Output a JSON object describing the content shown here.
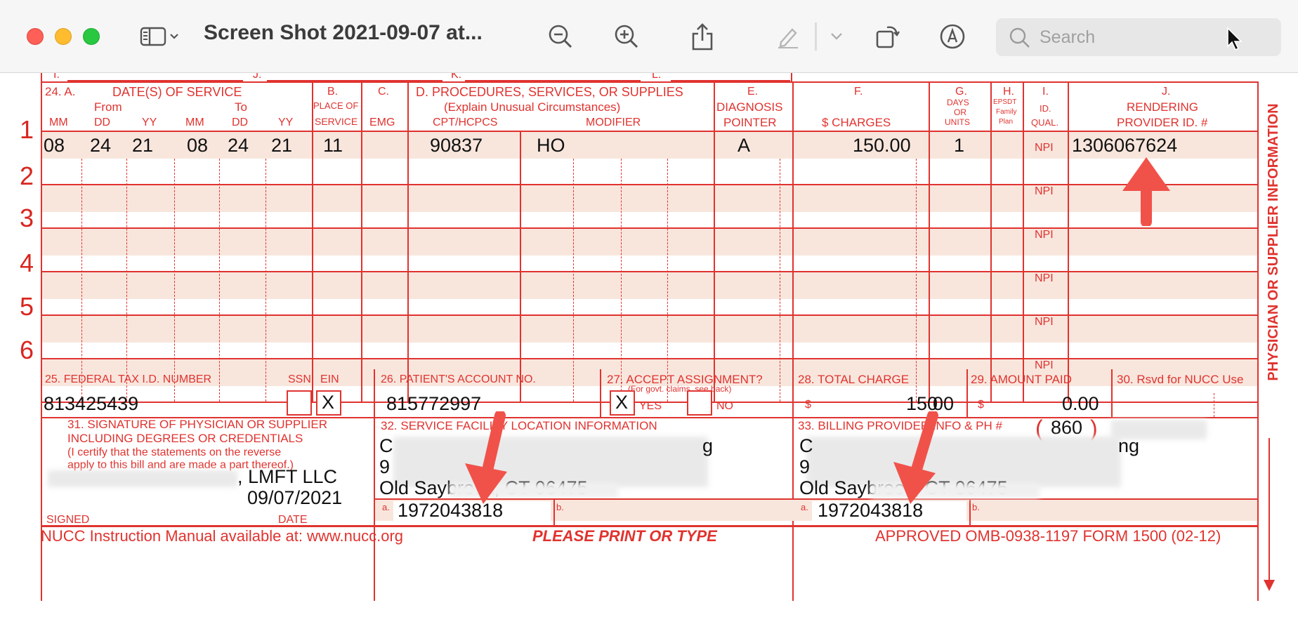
{
  "window": {
    "title": "Screen Shot 2021-09-07 at...",
    "search_placeholder": "Search"
  },
  "form": {
    "col_24a": "24. A.",
    "col_24a_title": "DATE(S) OF SERVICE",
    "col_from": "From",
    "col_to": "To",
    "col_mm": "MM",
    "col_dd": "DD",
    "col_yy": "YY",
    "col_b": "B.",
    "col_b_sub1": "PLACE OF",
    "col_b_sub2": "SERVICE",
    "col_c": "C.",
    "col_c_sub": "EMG",
    "col_d": "D. PROCEDURES, SERVICES, OR SUPPLIES",
    "col_d_sub": "(Explain Unusual Circumstances)",
    "col_cpt": "CPT/HCPCS",
    "col_modifier": "MODIFIER",
    "col_e": "E.",
    "col_e_sub1": "DIAGNOSIS",
    "col_e_sub2": "POINTER",
    "col_f": "F.",
    "col_f_sub": "$ CHARGES",
    "col_g": "G.",
    "col_g_sub1": "DAYS",
    "col_g_sub2": "OR",
    "col_g_sub3": "UNITS",
    "col_h": "H.",
    "col_h_sub1": "EPSDT",
    "col_h_sub2": "Family",
    "col_h_sub3": "Plan",
    "col_i": "I.",
    "col_i_sub1": "ID.",
    "col_i_sub2": "QUAL.",
    "col_j": "J.",
    "col_j_sub1": "RENDERING",
    "col_j_sub2": "PROVIDER ID. #",
    "top_letters": [
      "I.",
      "J.",
      "K.",
      "L."
    ],
    "row_numbers": [
      "1",
      "2",
      "3",
      "4",
      "5",
      "6"
    ],
    "npi_label": "NPI",
    "line1": {
      "from_mm": "08",
      "from_dd": "24",
      "from_yy": "21",
      "to_mm": "08",
      "to_dd": "24",
      "to_yy": "21",
      "place": "11",
      "cpt": "90837",
      "modifier": "HO",
      "pointer": "A",
      "charges": "150.00",
      "units": "1",
      "qual": "NPI",
      "provider_id": "1306067624"
    },
    "side_label": "PHYSICIAN OR SUPPLIER INFORMATION",
    "f25_label": "25. FEDERAL TAX I.D. NUMBER",
    "f25_ssn": "SSN",
    "f25_ein": "EIN",
    "f25_value": "813425439",
    "f25_ein_mark": "X",
    "f26_label": "26. PATIENT'S ACCOUNT NO.",
    "f26_value": "815772997",
    "f27_label": "27. ACCEPT ASSIGNMENT?",
    "f27_sub": "(For govt. claims, see back)",
    "f27_yes": "YES",
    "f27_no": "NO",
    "f27_mark": "X",
    "f28_label": "28. TOTAL CHARGE",
    "f28_currency": "$",
    "f28_value": "150",
    "f28_cents": "00",
    "f29_label": "29. AMOUNT PAID",
    "f29_currency": "$",
    "f29_value": "0.00",
    "f30_label": "30. Rsvd for NUCC Use",
    "f31_label1": "31. SIGNATURE OF PHYSICIAN OR SUPPLIER",
    "f31_label2": "INCLUDING DEGREES OR CREDENTIALS",
    "f31_label3": "(I certify that the statements on the reverse",
    "f31_label4": "apply to this bill and are made a part thereof.)",
    "f31_name": ", LMFT LLC",
    "f31_date": "09/07/2021",
    "f31_signed": "SIGNED",
    "f31_date_lbl": "DATE",
    "f32_label": "32. SERVICE FACILITY LOCATION INFORMATION",
    "f32_line1_end": "g",
    "f32_city": "Old Saybrook, CT 06475",
    "f32_a": "a.",
    "f32_a_value": "1972043818",
    "f32_b": "b.",
    "f33_label": "33. BILLING PROVIDER INFO & PH #",
    "f33_area": "860",
    "f33_line1_end": "ng",
    "f33_city": "Old Saybrook, CT 06475",
    "f33_a": "a.",
    "f33_a_value": "1972043818",
    "f33_b": "b.",
    "footer_left": "NUCC Instruction Manual available at: www.nucc.org",
    "footer_mid": "PLEASE PRINT OR TYPE",
    "footer_right": "APPROVED OMB-0938-1197 FORM 1500 (02-12)"
  },
  "colors": {
    "form_red": "#e0332f",
    "band": "#f8e6dd",
    "arrow": "#f0524a"
  }
}
